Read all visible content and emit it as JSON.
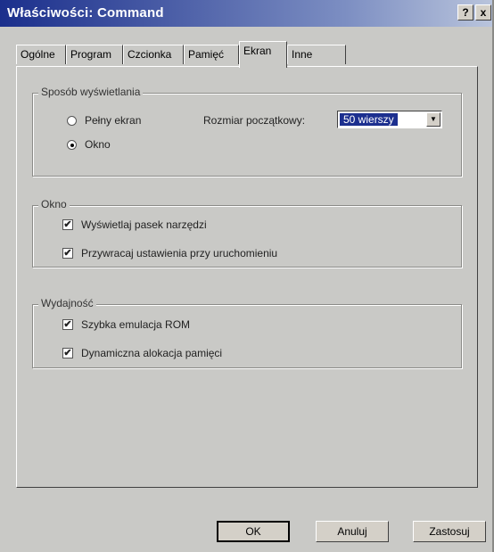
{
  "window": {
    "title": "Właściwości: Command",
    "help_label": "?",
    "close_label": "x"
  },
  "tabs": [
    {
      "label": "Ogólne"
    },
    {
      "label": "Program"
    },
    {
      "label": "Czcionka"
    },
    {
      "label": "Pamięć"
    },
    {
      "label": "Ekran"
    },
    {
      "label": "Inne"
    }
  ],
  "display_mode": {
    "legend": "Sposób wyświetlania",
    "fullscreen_label": "Pełny ekran",
    "fullscreen_selected": false,
    "window_label": "Okno",
    "window_selected": true,
    "initial_size_label": "Rozmiar początkowy:",
    "initial_size_value": "50 wierszy",
    "dropdown_icon": "triangle-down"
  },
  "window_group": {
    "legend": "Okno",
    "show_toolbar_label": "Wyświetlaj pasek narzędzi",
    "show_toolbar_checked": true,
    "restore_settings_label": "Przywracaj ustawienia przy uruchomieniu",
    "restore_settings_checked": true
  },
  "performance": {
    "legend": "Wydajność",
    "fast_rom_label": "Szybka emulacja ROM",
    "fast_rom_checked": true,
    "dynamic_memory_label": "Dynamiczna alokacja pamięci",
    "dynamic_memory_checked": true
  },
  "buttons": {
    "ok": "OK",
    "cancel": "Anuluj",
    "apply": "Zastosuj"
  },
  "colors": {
    "titlebar": "#1b2f8c",
    "selection": "#1c2f8f",
    "face": "#c9c9c6"
  }
}
